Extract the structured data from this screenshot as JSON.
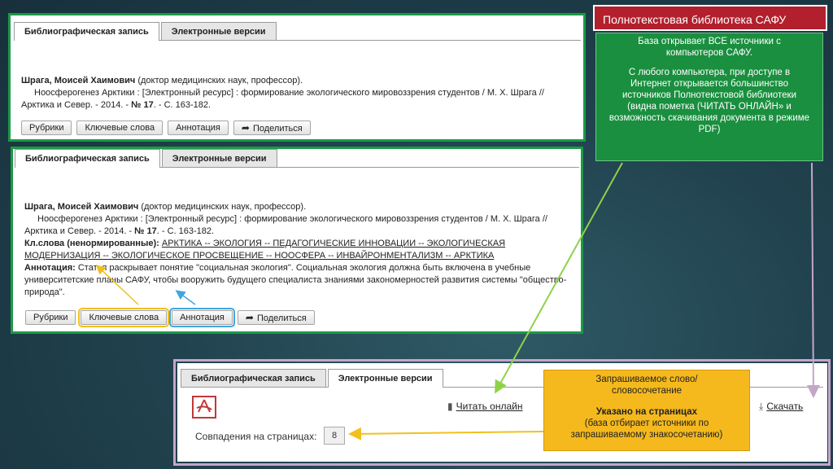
{
  "tabs": {
    "bib_record": "Библиографическая запись",
    "electronic_versions": "Электронные версии"
  },
  "record": {
    "author": "Шрага, Моисей Хаимович",
    "author_note": "(доктор медицинских наук, профессор).",
    "title_line": "Ноосферогенез Арктики : [Электронный ресурс] : формирование экологического мировоззрения студентов / М. Х. Шрага //",
    "source_line_a": "Арктика и Север. - 2014. -",
    "issue_label": "№ 17",
    "source_line_b": ". - С. 163-182.",
    "keywords_label": "Кл.слова (ненормированные):",
    "keywords_line1": "АРКТИКА -- ЭКОЛОГИЯ -- ПЕДАГОГИЧЕСКИЕ ИННОВАЦИИ -- ЭКОЛОГИЧЕСКАЯ",
    "keywords_line2": "МОДЕРНИЗАЦИЯ -- ЭКОЛОГИЧЕСКОЕ ПРОСВЕЩЕНИЕ -- НООСФЕРА -- ИНВАЙРОНМЕНТАЛИЗМ -- АРКТИКА",
    "annotation_label": "Аннотация:",
    "annotation_line1": "Статья раскрывает понятие \"социальная экология\". Социальная экология должна быть включена в учебные",
    "annotation_line2": "университетские планы САФУ, чтобы вооружить будущего специалиста знаниями закономерностей развития системы \"общество-",
    "annotation_line3": "природа\"."
  },
  "buttons": {
    "rubrics": "Рубрики",
    "keywords": "Ключевые слова",
    "annotation": "Аннотация",
    "share": "Поделиться",
    "share_icon": "share-arrow-icon"
  },
  "title_box": "Полнотекстовая библиотека САФУ",
  "info": {
    "p1": "База открывает ВСЕ источники с компьютеров САФУ.",
    "p2": "С любого компьютера, при доступе в Интернет открывается большинство источников Полнотекстовой библиотеки (видна пометка (ЧИТАТЬ ОНЛАЙН» и возможность скачивания документа в режиме PDF)"
  },
  "bottom": {
    "read_online": "Читать онлайн",
    "download": "Скачать",
    "matches_label": "Совпадения на страницах:",
    "matches_value": "8",
    "pdf_icon": "pdf-file-icon"
  },
  "orange": {
    "line1": "Запрашиваемое слово/словосочетание",
    "line2": "Указано на страницах",
    "line3": "(база отбирает источники по запрашиваемому знакосочетанию)"
  },
  "colors": {
    "green": "#1b9a45",
    "red": "#b3202d",
    "orange": "#f5b91d",
    "yellow_highlight": "#f2c01e",
    "blue_highlight": "#3fa7de"
  }
}
